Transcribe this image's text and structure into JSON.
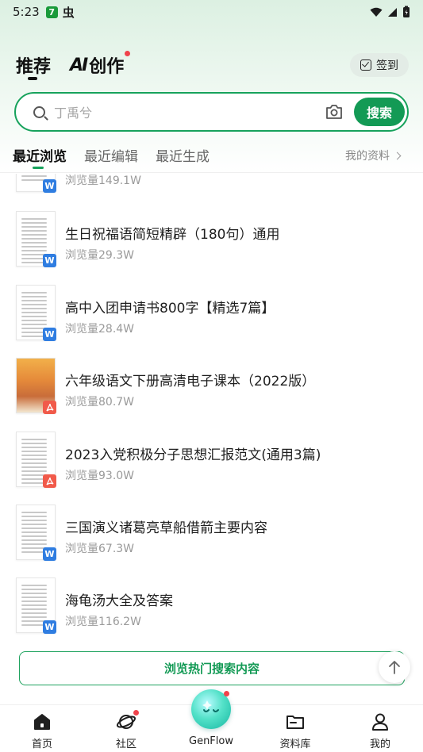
{
  "status_bar": {
    "time": "5:23",
    "app_badge": "7",
    "app_glyph": "虫"
  },
  "header": {
    "tab_recommend": "推荐",
    "tab_ai_logo": "AI",
    "tab_ai_label": "创作",
    "checkin_label": "签到"
  },
  "search": {
    "placeholder": "丁禹兮",
    "button_label": "搜索"
  },
  "subtabs": {
    "recent_browse": "最近浏览",
    "recent_edit": "最近编辑",
    "recent_generated": "最近生成",
    "my_docs": "我的资料"
  },
  "documents": [
    {
      "title": "",
      "views": "浏览量149.1W",
      "type": "W",
      "icon": "word-icon"
    },
    {
      "title": "生日祝福语简短精辟（180句）通用",
      "views": "浏览量29.3W",
      "type": "W",
      "icon": "word-icon"
    },
    {
      "title": "高中入团申请书800字【精选7篇】",
      "views": "浏览量28.4W",
      "type": "W",
      "icon": "word-icon"
    },
    {
      "title": "六年级语文下册高清电子课本（2022版）",
      "views": "浏览量80.7W",
      "type": "PDF",
      "icon": "pdf-icon"
    },
    {
      "title": "2023入党积极分子思想汇报范文(通用3篇)",
      "views": "浏览量93.0W",
      "type": "PDF",
      "icon": "pdf-icon"
    },
    {
      "title": "三国演义诸葛亮草船借箭主要内容",
      "views": "浏览量67.3W",
      "type": "W",
      "icon": "word-icon"
    },
    {
      "title": "海龟汤大全及答案",
      "views": "浏览量116.2W",
      "type": "W",
      "icon": "word-icon"
    }
  ],
  "hot_button": "浏览热门搜索内容",
  "bottom_nav": {
    "home": "首页",
    "community": "社区",
    "genflow": "GenFlow",
    "library": "资料库",
    "mine": "我的"
  },
  "colors": {
    "accent": "#139a55",
    "word": "#2f7de1",
    "pdf": "#f15a4a",
    "dot": "#f0434b"
  }
}
